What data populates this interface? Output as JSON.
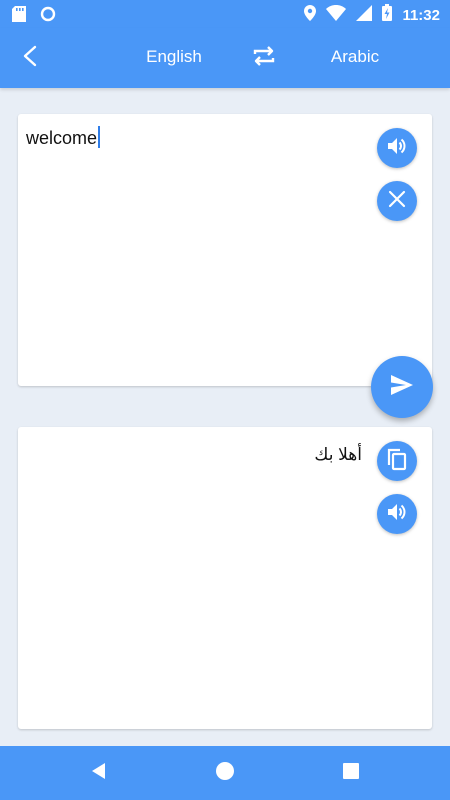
{
  "status_bar": {
    "time": "11:32",
    "icons": [
      "sd-card-icon",
      "circle-icon",
      "location-icon",
      "wifi-icon",
      "signal-icon",
      "battery-charging-icon"
    ]
  },
  "header": {
    "back_icon": "back-arrow-icon",
    "source_language": "English",
    "swap_icon": "swap-icon",
    "target_language": "Arabic"
  },
  "input": {
    "text": "welcome",
    "actions": [
      "speaker-icon",
      "clear-icon"
    ]
  },
  "send_icon": "send-icon",
  "output": {
    "text": "أهلا بك",
    "actions": [
      "copy-icon",
      "speaker-icon"
    ]
  },
  "nav": [
    "back-triangle-icon",
    "home-circle-icon",
    "recents-square-icon"
  ],
  "colors": {
    "primary": "#4a97f7",
    "background": "#e8eef6",
    "card": "#ffffff",
    "caret": "#2f7de8"
  }
}
